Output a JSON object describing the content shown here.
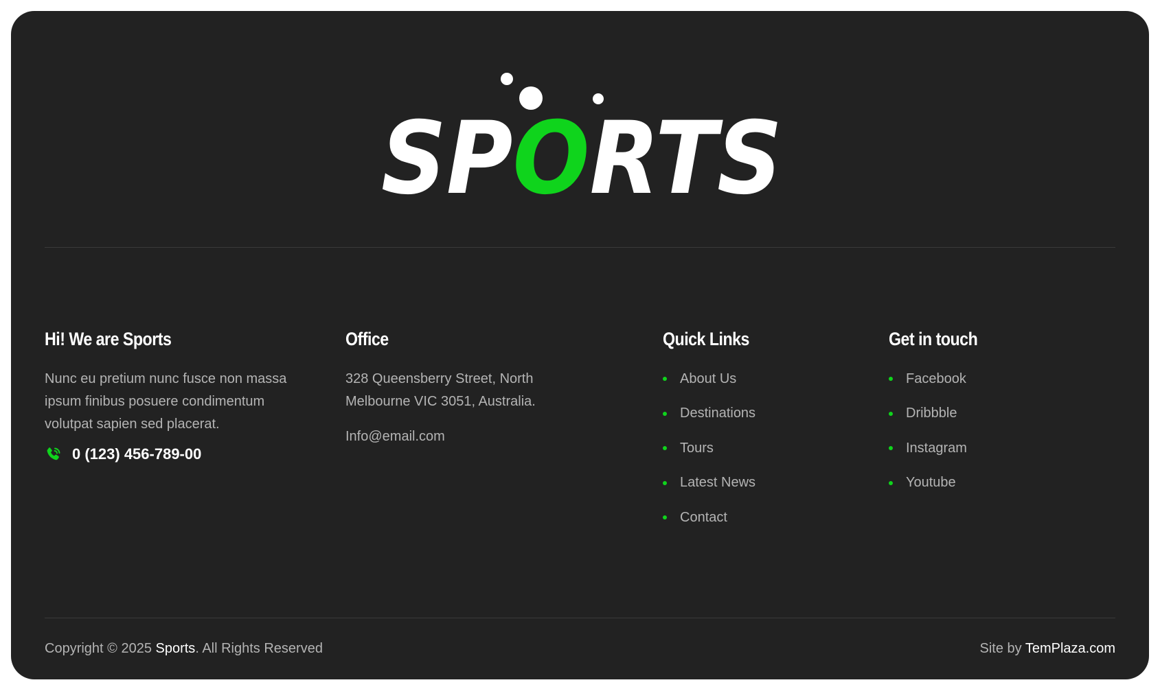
{
  "brand": {
    "logo_text": "SPORTS",
    "accent_color": "#0fd41c"
  },
  "about": {
    "heading": "Hi! We are Sports",
    "text": "Nunc eu pretium nunc fusce non massa ipsum finibus posuere condimentum volutpat sapien sed placerat.",
    "phone_icon": "phone-call-icon",
    "phone": "0 (123) 456-789-00"
  },
  "office": {
    "heading": "Office",
    "address": "328 Queensberry Street, North Melbourne VIC 3051, Australia.",
    "email": "Info@email.com"
  },
  "quick_links": {
    "heading": "Quick Links",
    "items": [
      {
        "label": "About Us"
      },
      {
        "label": "Destinations"
      },
      {
        "label": "Tours"
      },
      {
        "label": "Latest News"
      },
      {
        "label": "Contact"
      }
    ]
  },
  "get_in_touch": {
    "heading": "Get in touch",
    "items": [
      {
        "label": "Facebook"
      },
      {
        "label": "Dribbble"
      },
      {
        "label": "Instagram"
      },
      {
        "label": "Youtube"
      }
    ]
  },
  "bottom_bar": {
    "copyright_prefix": "Copyright © 2025 ",
    "copyright_brand": "Sports",
    "copyright_suffix": ". All Rights Reserved",
    "siteby_prefix": "Site by ",
    "siteby_brand": "TemPlaza.com"
  }
}
